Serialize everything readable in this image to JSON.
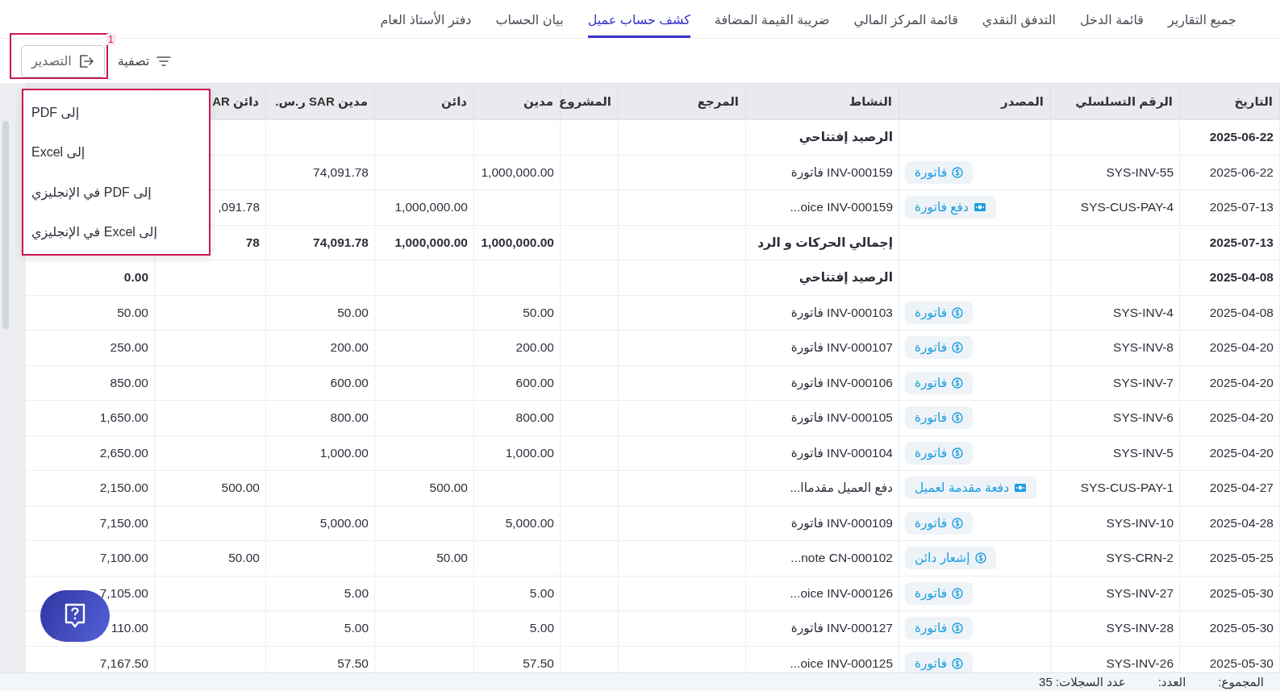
{
  "tabs": [
    {
      "label": "جميع التقارير",
      "selected": false
    },
    {
      "label": "قائمة الدخل",
      "selected": false
    },
    {
      "label": "التدفق النقدي",
      "selected": false
    },
    {
      "label": "قائمة المركز المالي",
      "selected": false
    },
    {
      "label": "ضريبة القيمة المضافة",
      "selected": false
    },
    {
      "label": "كشف حساب عميل",
      "selected": true
    },
    {
      "label": "بيان الحساب",
      "selected": false
    },
    {
      "label": "دفتر الأستاذ العام",
      "selected": false
    }
  ],
  "toolbar": {
    "filter": "تصفية",
    "export": "التصدير"
  },
  "annotation": {
    "label": "1"
  },
  "export_menu": [
    "إلى PDF",
    "إلى Excel",
    "إلى PDF في الإنجليزي",
    "إلى Excel في الإنجليزي"
  ],
  "table": {
    "columns": [
      "التاريخ",
      "الرقم التسلسلي",
      "المصدر",
      "النشاط",
      "المرجع",
      "المشروع",
      "مدين",
      "دائن",
      "مدين SAR ر.س.",
      "دائن AR"
    ],
    "rows": [
      {
        "kind": "summary",
        "date": "2025-06-22",
        "activity": "الرصيد إفتتاحي"
      },
      {
        "kind": "entry",
        "date": "2025-06-22",
        "serial": "SYS-INV-55",
        "source": {
          "kind": "coin",
          "label": "فاتورة"
        },
        "activity": "فاتورة INV-000159",
        "debit": "1,000,000.00",
        "debit_sar": "74,091.78"
      },
      {
        "kind": "entry",
        "date": "2025-07-13",
        "serial": "SYS-CUS-PAY-4",
        "source": {
          "kind": "cash",
          "label": "دفع فاتورة"
        },
        "activity": "...oice INV-000159",
        "credit": "1,000,000.00",
        "credit_sar": ",091.78"
      },
      {
        "kind": "summary",
        "date": "2025-07-13",
        "activity": "إجمالي الحركات و الرد",
        "debit": "1,000,000.00",
        "credit": "1,000,000.00",
        "debit_sar": "74,091.78",
        "credit_sar": "78"
      },
      {
        "kind": "summary",
        "date": "2025-04-08",
        "activity": "الرصيد إفتتاحي",
        "column_11": "0.00"
      },
      {
        "kind": "entry",
        "date": "2025-04-08",
        "serial": "SYS-INV-4",
        "source": {
          "kind": "coin",
          "label": "فاتورة"
        },
        "activity": "فاتورة INV-000103",
        "debit": "50.00",
        "debit_sar": "50.00",
        "column_11": "50.00"
      },
      {
        "kind": "entry",
        "date": "2025-04-20",
        "serial": "SYS-INV-8",
        "source": {
          "kind": "coin",
          "label": "فاتورة"
        },
        "activity": "فاتورة INV-000107",
        "debit": "200.00",
        "debit_sar": "200.00",
        "column_11": "250.00"
      },
      {
        "kind": "entry",
        "date": "2025-04-20",
        "serial": "SYS-INV-7",
        "source": {
          "kind": "coin",
          "label": "فاتورة"
        },
        "activity": "فاتورة INV-000106",
        "debit": "600.00",
        "debit_sar": "600.00",
        "column_11": "850.00"
      },
      {
        "kind": "entry",
        "date": "2025-04-20",
        "serial": "SYS-INV-6",
        "source": {
          "kind": "coin",
          "label": "فاتورة"
        },
        "activity": "فاتورة INV-000105",
        "debit": "800.00",
        "debit_sar": "800.00",
        "column_11": "1,650.00"
      },
      {
        "kind": "entry",
        "date": "2025-04-20",
        "serial": "SYS-INV-5",
        "source": {
          "kind": "coin",
          "label": "فاتورة"
        },
        "activity": "فاتورة INV-000104",
        "debit": "1,000.00",
        "debit_sar": "1,000.00",
        "column_11": "2,650.00"
      },
      {
        "kind": "entry",
        "date": "2025-04-27",
        "serial": "SYS-CUS-PAY-1",
        "source": {
          "kind": "cash",
          "label": "دفعة مقدمة لعميل"
        },
        "activity": "...دفع العميل مقدماا",
        "credit": "500.00",
        "credit_sar": "500.00",
        "column_11": "2,150.00"
      },
      {
        "kind": "entry",
        "date": "2025-04-28",
        "serial": "SYS-INV-10",
        "source": {
          "kind": "coin",
          "label": "فاتورة"
        },
        "activity": "فاتورة INV-000109",
        "debit": "5,000.00",
        "debit_sar": "5,000.00",
        "column_11": "7,150.00"
      },
      {
        "kind": "entry",
        "date": "2025-05-25",
        "serial": "SYS-CRN-2",
        "source": {
          "kind": "coin",
          "label": "إشعار دائن"
        },
        "activity": "...note CN-000102",
        "credit": "50.00",
        "credit_sar": "50.00",
        "column_11": "7,100.00"
      },
      {
        "kind": "entry",
        "date": "2025-05-30",
        "serial": "SYS-INV-27",
        "source": {
          "kind": "coin",
          "label": "فاتورة"
        },
        "activity": "...oice INV-000126",
        "debit": "5.00",
        "debit_sar": "5.00",
        "column_11": "7,105.00"
      },
      {
        "kind": "entry",
        "date": "2025-05-30",
        "serial": "SYS-INV-28",
        "source": {
          "kind": "coin",
          "label": "فاتورة"
        },
        "activity": "فاتورة INV-000127",
        "debit": "5.00",
        "debit_sar": "5.00",
        "column_11": "110.00"
      },
      {
        "kind": "entry",
        "date": "2025-05-30",
        "serial": "SYS-INV-26",
        "source": {
          "kind": "coin",
          "label": "فاتورة"
        },
        "activity": "...oice INV-000125",
        "debit": "57.50",
        "debit_sar": "57.50",
        "column_11": "7,167.50"
      }
    ]
  },
  "footer": {
    "total": "المجموع:",
    "count": "العدد:",
    "records": "عدد السجلات: 35"
  }
}
